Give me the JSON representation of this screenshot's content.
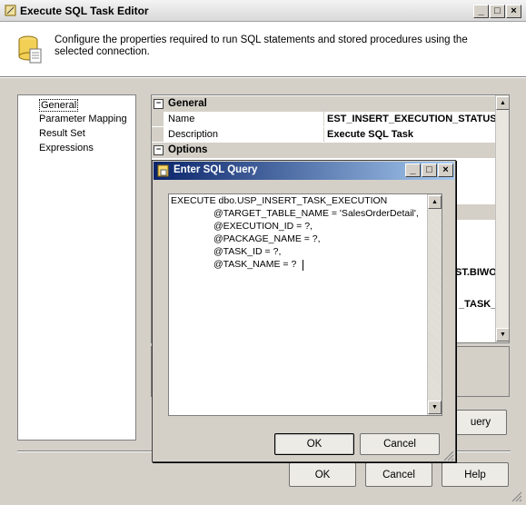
{
  "window": {
    "title": "Execute SQL Task Editor"
  },
  "header": {
    "description": "Configure the properties required to run SQL statements and stored procedures using the selected connection."
  },
  "nav": {
    "items": [
      "General",
      "Parameter Mapping",
      "Result Set",
      "Expressions"
    ],
    "selected": "General"
  },
  "grid": {
    "general_category": "General",
    "name_label": "Name",
    "name_value": "EST_INSERT_EXECUTION_STATUS",
    "description_label": "Description",
    "description_value": "Execute SQL Task",
    "options_category": "Options",
    "obscured_value_1": "ST.BIWO",
    "obscured_value_2": "_TASK_"
  },
  "background_button_fragment": "uery",
  "footer": {
    "ok": "OK",
    "cancel": "Cancel",
    "help": "Help"
  },
  "dialog": {
    "title": "Enter SQL Query",
    "sql_lines": [
      "EXECUTE dbo.USP_INSERT_TASK_EXECUTION",
      "@TARGET_TABLE_NAME = 'SalesOrderDetail',",
      "@EXECUTION_ID = ?,",
      "@PACKAGE_NAME = ?,",
      "@TASK_ID = ?,",
      "@TASK_NAME = ?"
    ],
    "ok": "OK",
    "cancel": "Cancel"
  }
}
